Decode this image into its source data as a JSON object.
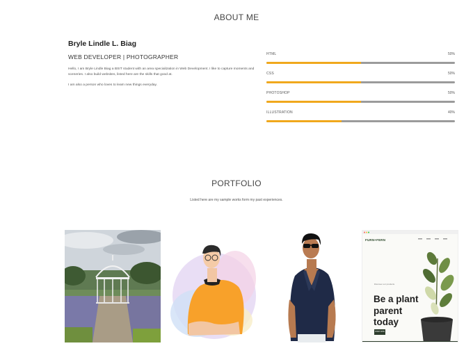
{
  "about": {
    "title": "ABOUT ME",
    "name": "Bryle Lindle L. Biag",
    "role": "WEB DEVELOPER | PHOTOGRAPHER",
    "paragraphs": [
      "Hello, I am Bryle Lindle Biag a BSIT student with an area specialization in Web Development. I like to capture moments and sceneries. I also build websites, listed here are the skills that good at.",
      "I am also a person who loves to learn new things everyday."
    ],
    "skills": [
      {
        "label": "HTML",
        "percent_text": "50%",
        "value": 0.5
      },
      {
        "label": "CSS",
        "percent_text": "50%",
        "value": 0.5
      },
      {
        "label": "PHOTOSHOP",
        "percent_text": "50%",
        "value": 0.5
      },
      {
        "label": "ILLUSTRATION",
        "percent_text": "40%",
        "value": 0.4
      }
    ]
  },
  "portfolio": {
    "title": "PORTFOLIO",
    "subtitle": "Listed here are my sample works form my past experiences.",
    "website": {
      "brand": "FURN+FERN",
      "tagline": "Discover our products",
      "headline": "Be a plant parent today",
      "button": "SHOP NOW"
    }
  },
  "colors": {
    "skill_fill": "#f0a81c",
    "skill_track": "#9b9b9b"
  },
  "icons": {
    "portfolio_items": [
      "gazebo-garden-photo",
      "avatar-illustration-orange-shirt",
      "avatar-illustration-sunglasses",
      "plant-website-screenshot"
    ]
  }
}
